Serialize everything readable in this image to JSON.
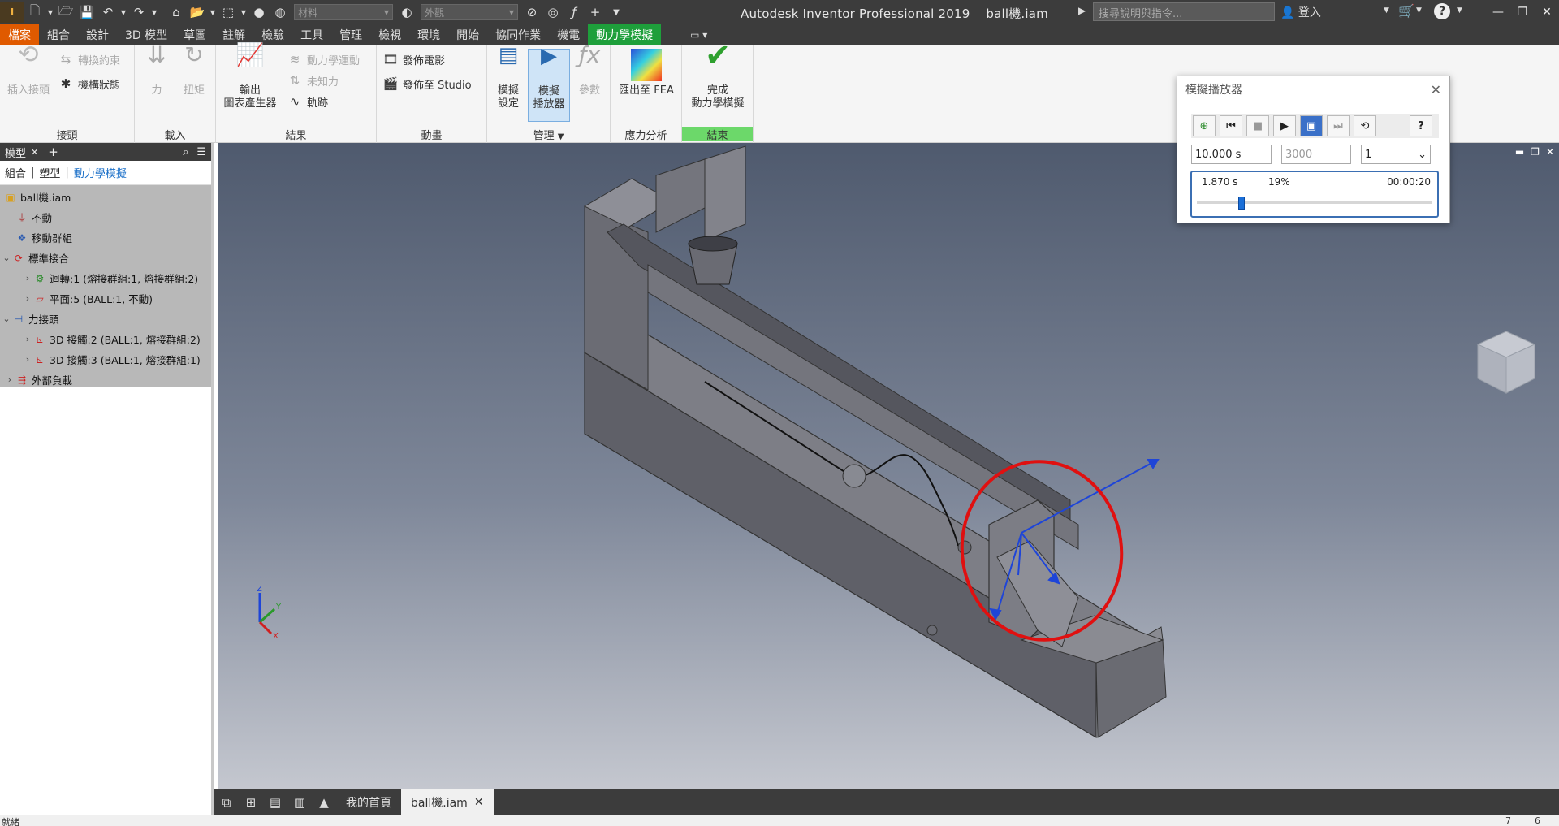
{
  "title": "Autodesk Inventor Professional 2019",
  "document": "ball機.iam",
  "quick_access": {
    "material_combo": "材料",
    "appearance_combo": "外觀"
  },
  "search_placeholder": "搜尋說明與指令...",
  "login": "登入",
  "tabs": [
    "檔案",
    "組合",
    "設計",
    "3D 模型",
    "草圖",
    "註解",
    "檢驗",
    "工具",
    "管理",
    "檢視",
    "環境",
    "開始",
    "協同作業",
    "機電",
    "動力學模擬"
  ],
  "ribbon": {
    "panels": {
      "joints": "接頭",
      "loads": "載入",
      "results": "結果",
      "animate": "動畫",
      "manage": "管理",
      "stress": "應力分析",
      "finish": "結束"
    },
    "buttons": {
      "insert_joint": "插入接頭",
      "convert_constraints": "轉換約束",
      "mechanism_status": "機構狀態",
      "force": "力",
      "torque": "扭矩",
      "output_grapher_1": "輸出",
      "output_grapher_2": "圖表產生器",
      "dynamic_motion": "動力學運動",
      "unknown_force": "未知力",
      "trace": "軌跡",
      "publish_movie": "發佈電影",
      "publish_studio": "發佈至 Studio",
      "sim_settings_1": "模擬",
      "sim_settings_2": "設定",
      "sim_player_1": "模擬",
      "sim_player_2": "播放器",
      "parameters": "參數",
      "export_fea": "匯出至 FEA",
      "finish_1": "完成",
      "finish_2": "動力學模擬"
    }
  },
  "browser": {
    "tab_label": "模型",
    "sub_tabs": [
      "組合",
      "塑型",
      "動力學模擬"
    ],
    "tree": [
      {
        "label": "ball機.iam",
        "level": 0,
        "icon": "assembly-icon"
      },
      {
        "label": "不動",
        "level": 1,
        "icon": "grounded-icon"
      },
      {
        "label": "移動群組",
        "level": 1,
        "icon": "mobile-group-icon"
      },
      {
        "label": "標準接合",
        "level": 1,
        "icon": "standard-joint-icon"
      },
      {
        "label": "迴轉:1 (熔接群組:1, 熔接群組:2)",
        "level": 2,
        "icon": "revolution-joint-icon"
      },
      {
        "label": "平面:5 (BALL:1, 不動)",
        "level": 2,
        "icon": "planar-joint-icon"
      },
      {
        "label": "力接頭",
        "level": 1,
        "icon": "force-joint-icon"
      },
      {
        "label": "3D 接觸:2 (BALL:1, 熔接群組:2)",
        "level": 2,
        "icon": "contact-joint-icon"
      },
      {
        "label": "3D 接觸:3 (BALL:1, 熔接群組:1)",
        "level": 2,
        "icon": "contact-joint-icon"
      },
      {
        "label": "外部負載",
        "level": 1,
        "icon": "external-load-icon"
      }
    ]
  },
  "sim_player": {
    "title": "模擬播放器",
    "final_time": "10.000 s",
    "images": "3000",
    "filter": "1",
    "current_time": "1.870 s",
    "percent": "19%",
    "elapsed": "00:00:20",
    "progress": 0.19
  },
  "doc_tabs": {
    "home": "我的首頁",
    "active": "ball機.iam"
  },
  "status_text": "就緒",
  "status_numbers": [
    "7",
    "6"
  ],
  "triad": {
    "z": "Z",
    "y": "Y",
    "x": "X"
  },
  "colors": {
    "accent": "#1e9f3b",
    "file_tab": "#e05a00",
    "annotation": "#e01010"
  }
}
